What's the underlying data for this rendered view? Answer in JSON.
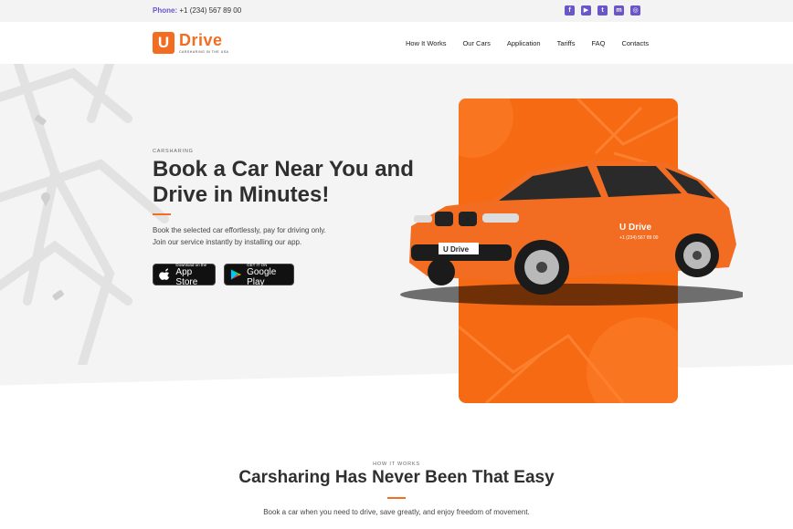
{
  "topbar": {
    "phone_label": "Phone:",
    "phone_number": "+1 (234) 567 89 00",
    "socials": [
      {
        "icon": "facebook-icon",
        "glyph": "f"
      },
      {
        "icon": "youtube-icon",
        "glyph": "▶"
      },
      {
        "icon": "twitter-icon",
        "glyph": "t"
      },
      {
        "icon": "messenger-icon",
        "glyph": "m"
      },
      {
        "icon": "instagram-icon",
        "glyph": "◎"
      }
    ]
  },
  "header": {
    "logo_letter": "U",
    "logo_word": "Drive",
    "logo_tagline": "CARSHARING IN THE USA",
    "nav": [
      "How It Works",
      "Our Cars",
      "Application",
      "Tariffs",
      "FAQ",
      "Contacts"
    ]
  },
  "hero": {
    "kicker": "CARSHARING",
    "headline": "Book a Car Near You and Drive in Minutes!",
    "description_line1": "Book the selected car effortlessly, pay for driving only.",
    "description_line2": "Join our service instantly by installing our app.",
    "appstore_small": "Download on the",
    "appstore_big": "App Store",
    "googleplay_small": "GET IT ON",
    "googleplay_big": "Google Play",
    "car_brand": "U Drive",
    "car_phone": "+1 (234) 567 89 00"
  },
  "how_it_works": {
    "kicker": "HOW IT WORKS",
    "title": "Carsharing Has Never Been That Easy",
    "description": "Book a car when you need to drive, save greatly, and enjoy freedom of movement."
  },
  "colors": {
    "accent": "#f26d21",
    "social": "#6a55c9",
    "hero_bg": "#f4f4f4"
  }
}
